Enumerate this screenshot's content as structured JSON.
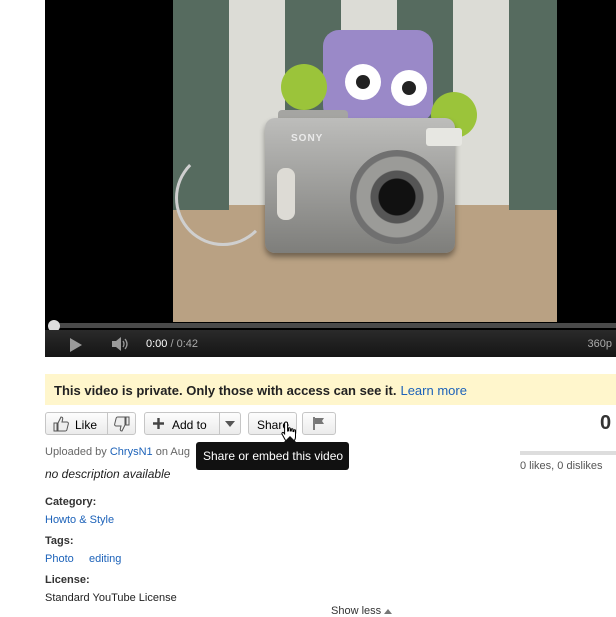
{
  "player": {
    "time_current": "0:00",
    "time_total": "/ 0:42",
    "quality": "360p",
    "progress_fraction": 0.0
  },
  "video": {
    "camera_brand": "SONY"
  },
  "notice": {
    "message": "This video is private. Only those with access can see it.",
    "link": "Learn more"
  },
  "actions": {
    "like_label": "Like",
    "add_to_label": "Add to",
    "share_label": "Share"
  },
  "stats": {
    "view_count": "0",
    "likes_text": "0 likes, 0 dislikes"
  },
  "tooltip": "Share or embed this video",
  "info": {
    "uploaded_prefix": "Uploaded by",
    "uploader": "ChrysN1",
    "uploaded_suffix": "on Aug",
    "description": "no description available",
    "category_label": "Category:",
    "category": "Howto & Style",
    "tags_label": "Tags:",
    "tags": [
      "Photo",
      "editing"
    ],
    "license_label": "License:",
    "license": "Standard YouTube License",
    "show_less": "Show less"
  },
  "colors": {
    "link": "#1c62b9",
    "notice_bg": "#fff6cc",
    "player_bg": "#000000"
  }
}
